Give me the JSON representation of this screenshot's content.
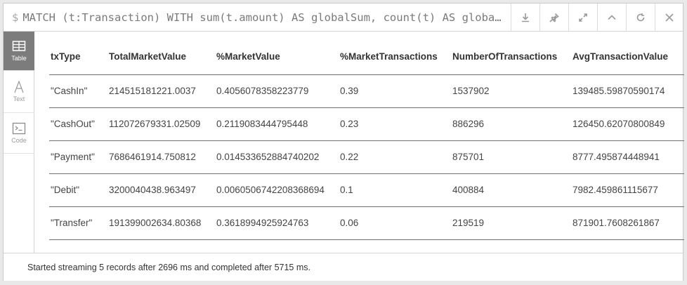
{
  "query": {
    "prompt_symbol": "$",
    "text": "MATCH (t:Transaction) WITH sum(t.amount) AS globalSum, count(t) AS globa…"
  },
  "header_buttons": [
    {
      "icon": "download-icon"
    },
    {
      "icon": "pin-icon"
    },
    {
      "icon": "expand-icon"
    },
    {
      "icon": "collapse-up-icon"
    },
    {
      "icon": "rerun-icon"
    },
    {
      "icon": "close-icon"
    }
  ],
  "views": [
    {
      "label": "Table",
      "icon": "table-icon",
      "active": true
    },
    {
      "label": "Text",
      "icon": "text-icon",
      "active": false
    },
    {
      "label": "Code",
      "icon": "code-icon",
      "active": false
    }
  ],
  "table": {
    "columns": [
      "txType",
      "TotalMarketValue",
      "%MarketValue",
      "%MarketTransactions",
      "NumberOfTransactions",
      "AvgTransactionValue"
    ],
    "rows": [
      [
        "\"CashIn\"",
        "214515181221.0037",
        "0.4056078358223779",
        "0.39",
        "1537902",
        "139485.59870590174"
      ],
      [
        "\"CashOut\"",
        "112072679331.02509",
        "0.2119083444795448",
        "0.23",
        "886296",
        "126450.62070800849"
      ],
      [
        "\"Payment\"",
        "7686461914.750812",
        "0.014533652884740202",
        "0.22",
        "875701",
        "8777.495874448941"
      ],
      [
        "\"Debit\"",
        "3200040438.963497",
        "0.0060506742208368694",
        "0.1",
        "400884",
        "7982.459861115677"
      ],
      [
        "\"Transfer\"",
        "191399002634.80368",
        "0.3618994925924763",
        "0.06",
        "219519",
        "871901.7608261867"
      ]
    ]
  },
  "footer": {
    "status": "Started streaming 5 records after 2696 ms and completed after 5715 ms."
  }
}
